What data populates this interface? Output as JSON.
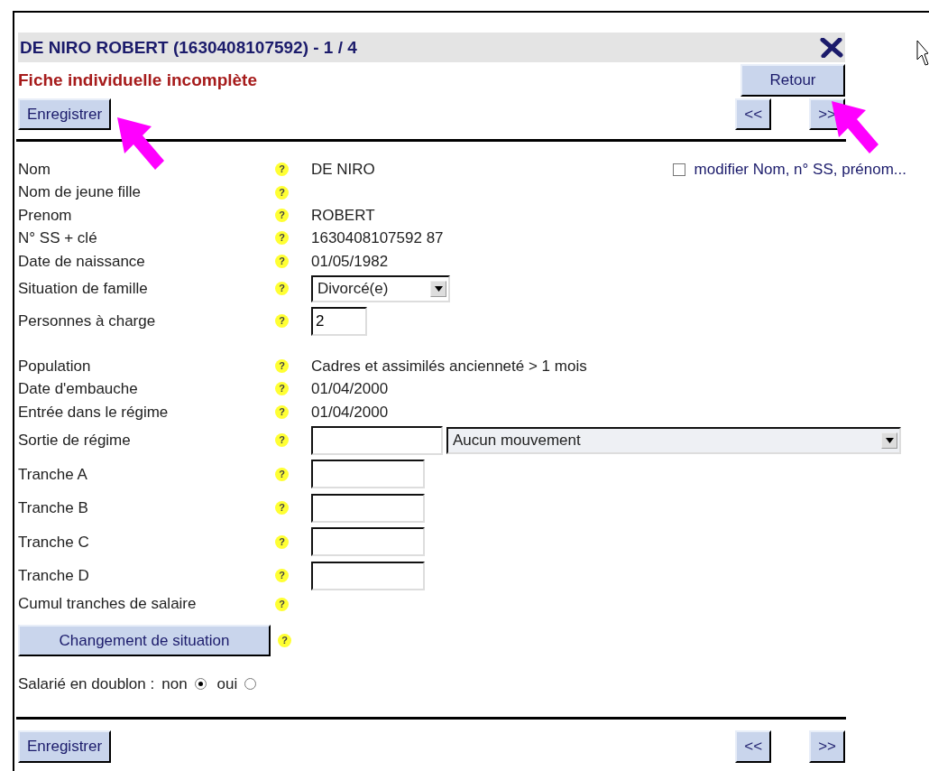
{
  "header": {
    "title": "DE NIRO ROBERT (1630408107592) - 1 / 4",
    "subtitle": "Fiche individuelle incomplète"
  },
  "top_buttons": {
    "back": "Retour",
    "save": "Enregistrer",
    "prev": "<<",
    "next": ">>"
  },
  "modify_option": {
    "label": "modifier Nom, n° SS, prénom...",
    "checked": false
  },
  "sections": [
    [
      {
        "label": "Nom",
        "help": "?",
        "kind": "text",
        "value": "DE NIRO"
      },
      {
        "label": "Nom de jeune fille",
        "help": "?",
        "kind": "text"
      },
      {
        "label": "Prenom",
        "help": "?",
        "kind": "text",
        "value": "ROBERT"
      },
      {
        "label": "N° SS + clé",
        "help": "?",
        "kind": "text",
        "value": "1630408107592 87"
      },
      {
        "label": "Date de naissance",
        "help": "?",
        "kind": "text",
        "value": "01/05/1982"
      },
      {
        "label": "Situation de famille",
        "help": "?",
        "kind": "select",
        "value": "Divorcé(e)"
      },
      {
        "label": "Personnes à charge",
        "help": "?",
        "kind": "input",
        "value": "2"
      }
    ],
    [
      {
        "label": "Population",
        "help": "?",
        "kind": "text",
        "value": "Cadres et assimilés ancienneté > 1 mois"
      },
      {
        "label": "Date d'embauche",
        "help": "?",
        "kind": "text",
        "value": "01/04/2000"
      },
      {
        "label": "Entrée dans le régime",
        "help": "?",
        "kind": "text",
        "value": "01/04/2000"
      },
      {
        "label": "Sortie de régime",
        "help": "?",
        "kind": "input_select",
        "option": "Aucun mouvement"
      },
      {
        "label": "Tranche A",
        "help": "?",
        "kind": "input"
      },
      {
        "label": "Tranche B",
        "help": "?",
        "kind": "input"
      },
      {
        "label": "Tranche C",
        "help": "?",
        "kind": "input"
      },
      {
        "label": "Tranche D",
        "help": "?",
        "kind": "input"
      },
      {
        "label": "Cumul tranches de salaire",
        "help": "?",
        "kind": "text"
      }
    ]
  ],
  "change_button": {
    "label": "Changement de situation",
    "help": "?"
  },
  "duplicate": {
    "label": "Salarié en doublon :",
    "options": [
      {
        "label": "non",
        "selected": true
      },
      {
        "label": "oui",
        "selected": false
      }
    ]
  },
  "bottom_buttons": {
    "save": "Enregistrer",
    "prev": "<<",
    "next": ">>"
  }
}
